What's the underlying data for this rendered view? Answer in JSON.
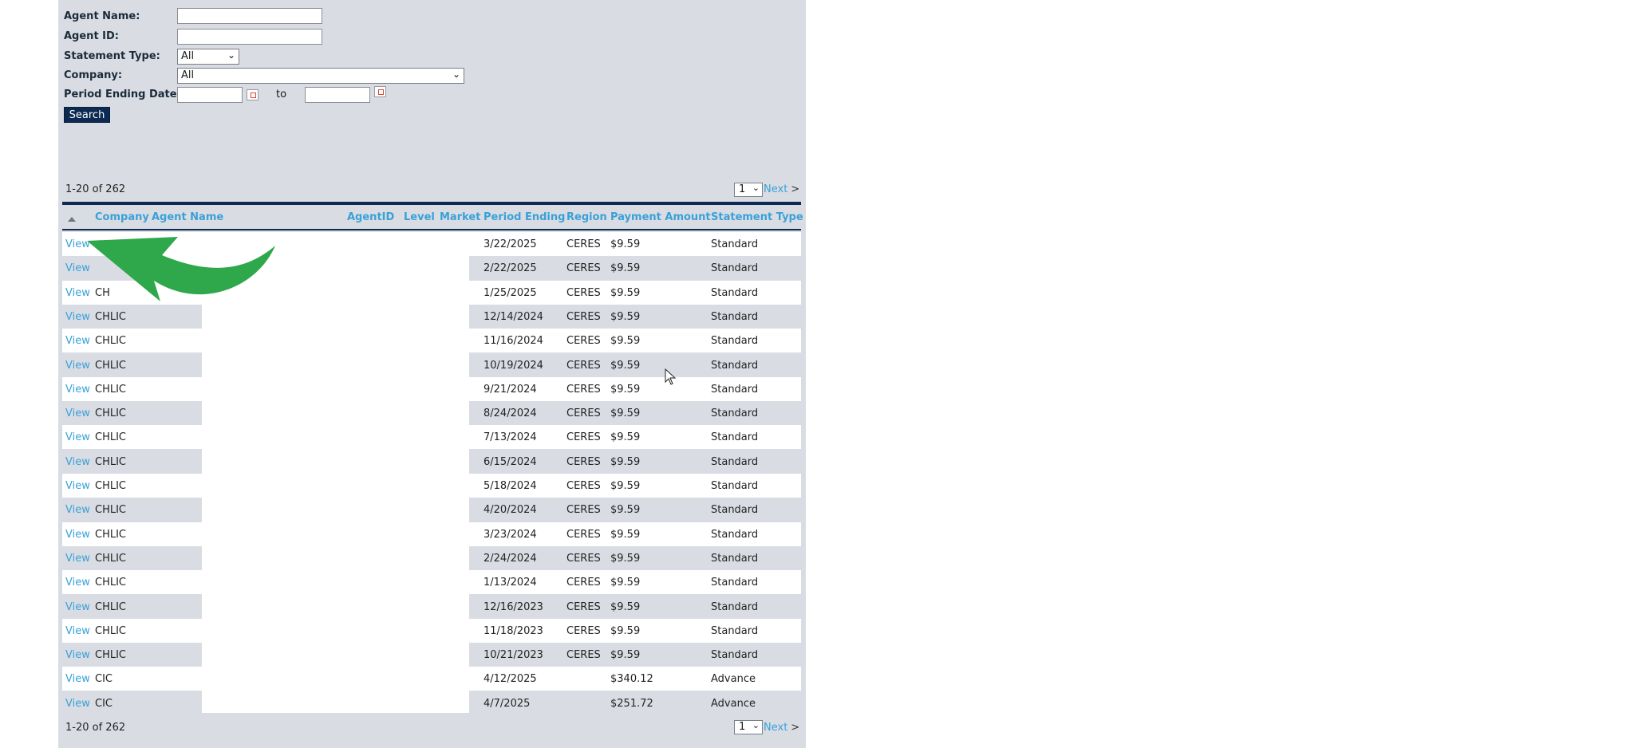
{
  "form": {
    "agent_name_label": "Agent Name:",
    "agent_name_value": "",
    "agent_id_label": "Agent ID:",
    "agent_id_value": "",
    "statement_type_label": "Statement Type:",
    "statement_type_value": "All",
    "company_label": "Company:",
    "company_value": "All",
    "period_label": "Period Ending Date:",
    "period_from_value": "",
    "period_to_label": "to",
    "period_to_value": "",
    "search_label": "Search"
  },
  "pager": {
    "range_text": "1-20 of 262",
    "page_value": "1",
    "next_label": "Next",
    "next_symbol": ">"
  },
  "table": {
    "headers": [
      "Company",
      "Agent Name",
      "AgentID",
      "Level",
      "Market",
      "Period Ending",
      "Region",
      "Payment Amount",
      "Statement Type"
    ],
    "view_label": "View",
    "rows": [
      {
        "company": "",
        "period": "3/22/2025",
        "region": "CERES",
        "amount": "$9.59",
        "type": "Standard"
      },
      {
        "company": "",
        "period": "2/22/2025",
        "region": "CERES",
        "amount": "$9.59",
        "type": "Standard"
      },
      {
        "company": "CH",
        "period": "1/25/2025",
        "region": "CERES",
        "amount": "$9.59",
        "type": "Standard"
      },
      {
        "company": "CHLIC",
        "period": "12/14/2024",
        "region": "CERES",
        "amount": "$9.59",
        "type": "Standard"
      },
      {
        "company": "CHLIC",
        "period": "11/16/2024",
        "region": "CERES",
        "amount": "$9.59",
        "type": "Standard"
      },
      {
        "company": "CHLIC",
        "period": "10/19/2024",
        "region": "CERES",
        "amount": "$9.59",
        "type": "Standard"
      },
      {
        "company": "CHLIC",
        "period": "9/21/2024",
        "region": "CERES",
        "amount": "$9.59",
        "type": "Standard"
      },
      {
        "company": "CHLIC",
        "period": "8/24/2024",
        "region": "CERES",
        "amount": "$9.59",
        "type": "Standard"
      },
      {
        "company": "CHLIC",
        "period": "7/13/2024",
        "region": "CERES",
        "amount": "$9.59",
        "type": "Standard"
      },
      {
        "company": "CHLIC",
        "period": "6/15/2024",
        "region": "CERES",
        "amount": "$9.59",
        "type": "Standard"
      },
      {
        "company": "CHLIC",
        "period": "5/18/2024",
        "region": "CERES",
        "amount": "$9.59",
        "type": "Standard"
      },
      {
        "company": "CHLIC",
        "period": "4/20/2024",
        "region": "CERES",
        "amount": "$9.59",
        "type": "Standard"
      },
      {
        "company": "CHLIC",
        "period": "3/23/2024",
        "region": "CERES",
        "amount": "$9.59",
        "type": "Standard"
      },
      {
        "company": "CHLIC",
        "period": "2/24/2024",
        "region": "CERES",
        "amount": "$9.59",
        "type": "Standard"
      },
      {
        "company": "CHLIC",
        "period": "1/13/2024",
        "region": "CERES",
        "amount": "$9.59",
        "type": "Standard"
      },
      {
        "company": "CHLIC",
        "period": "12/16/2023",
        "region": "CERES",
        "amount": "$9.59",
        "type": "Standard"
      },
      {
        "company": "CHLIC",
        "period": "11/18/2023",
        "region": "CERES",
        "amount": "$9.59",
        "type": "Standard"
      },
      {
        "company": "CHLIC",
        "period": "10/21/2023",
        "region": "CERES",
        "amount": "$9.59",
        "type": "Standard"
      },
      {
        "company": "CIC",
        "period": "4/12/2025",
        "region": "",
        "amount": "$340.12",
        "type": "Advance"
      },
      {
        "company": "CIC",
        "period": "4/7/2025",
        "region": "",
        "amount": "$251.72",
        "type": "Advance"
      }
    ]
  },
  "colors": {
    "panel_bg": "#d9dde3",
    "link": "#3aa0d8",
    "navy": "#0c2a52",
    "annotation_arrow": "#2ea84a"
  },
  "icons": {
    "calendar": "calendar-icon",
    "sort": "sort-ascending-icon",
    "cursor": "mouse-cursor-icon"
  }
}
